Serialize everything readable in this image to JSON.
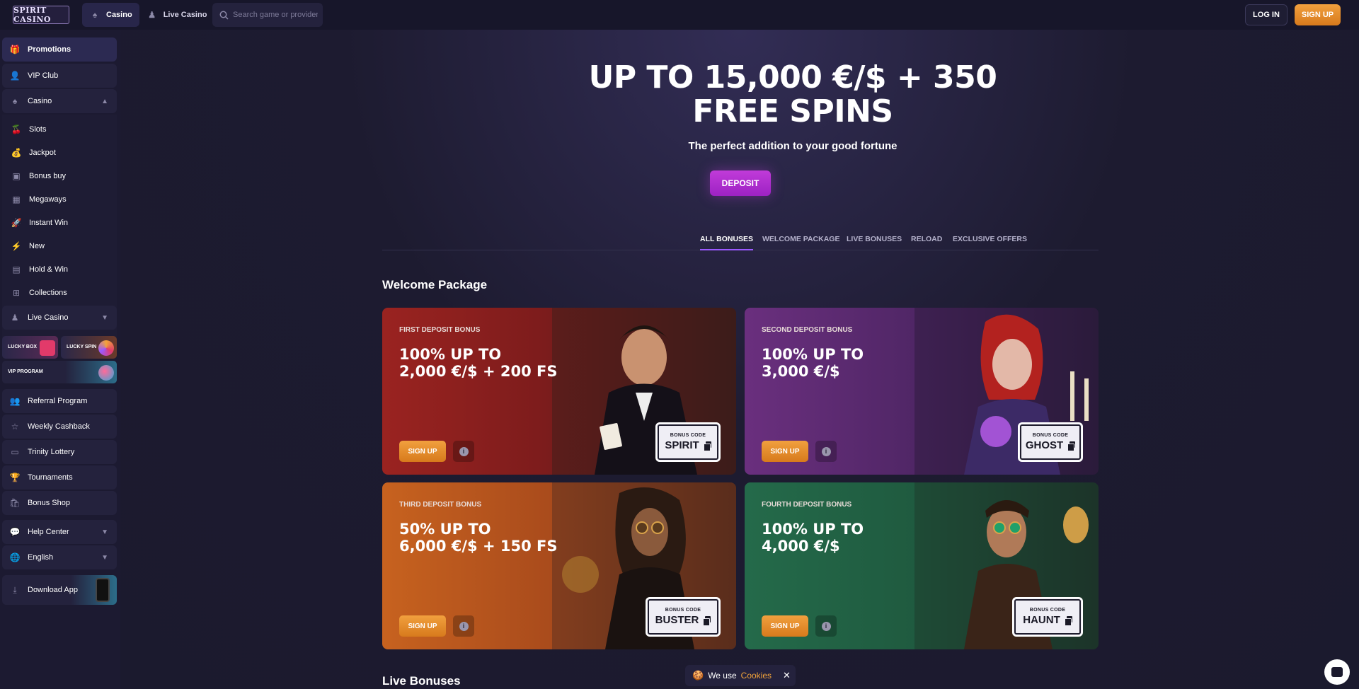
{
  "header": {
    "logo_text": "SPIRIT CASINO",
    "tabs": [
      {
        "label": "Casino",
        "icon": "spade-icon"
      },
      {
        "label": "Live Casino",
        "icon": "dealer-icon"
      }
    ],
    "search_placeholder": "Search game or provider",
    "login_label": "LOG IN",
    "signup_label": "SIGN UP"
  },
  "sidebar": {
    "promotions": "Promotions",
    "vip_club": "VIP Club",
    "casino": "Casino",
    "casino_items": [
      "Slots",
      "Jackpot",
      "Bonus buy",
      "Megaways",
      "Instant Win",
      "New",
      "Hold & Win",
      "Collections"
    ],
    "live_casino": "Live Casino",
    "lucky_box": "LUCKY BOX",
    "lucky_spin": "LUCKY SPIN",
    "vip_program": "VIP PROGRAM",
    "referral": "Referral Program",
    "weekly_cashback": "Weekly Cashback",
    "trinity_lottery": "Trinity Lottery",
    "tournaments": "Tournaments",
    "bonus_shop": "Bonus Shop",
    "help_center": "Help Center",
    "language": "English",
    "download_app": "Download App"
  },
  "hero": {
    "title_line1": "UP TO 15,000 €/$ + 350",
    "title_line2": "FREE SPINS",
    "subtitle": "The perfect addition to your good fortune",
    "deposit_label": "DEPOSIT"
  },
  "filters": [
    "ALL BONUSES",
    "WELCOME PACKAGE",
    "LIVE BONUSES",
    "RELOAD",
    "EXCLUSIVE OFFERS"
  ],
  "welcome": {
    "title": "Welcome Package",
    "cards": [
      {
        "label": "FIRST DEPOSIT BONUS",
        "line1": "100% UP TO",
        "line2": "2,000 €/$ + 200 FS",
        "signup": "SIGN UP",
        "code_label": "BONUS CODE",
        "code": "SPIRIT",
        "color": "#8e1f1c"
      },
      {
        "label": "SECOND DEPOSIT BONUS",
        "line1": "100% UP TO",
        "line2": "3,000 €/$",
        "signup": "SIGN UP",
        "code_label": "BONUS CODE",
        "code": "GHOST",
        "color": "#5a2a6e"
      },
      {
        "label": "THIRD DEPOSIT BONUS",
        "line1": "50% UP TO",
        "line2": "6,000 €/$ + 150 FS",
        "signup": "SIGN UP",
        "code_label": "BONUS CODE",
        "code": "BUSTER",
        "color": "#b5561f"
      },
      {
        "label": "FOURTH DEPOSIT BONUS",
        "line1": "100% UP TO",
        "line2": "4,000 €/$",
        "signup": "SIGN UP",
        "code_label": "BONUS CODE",
        "code": "HAUNT",
        "color": "#1f5a3f"
      }
    ]
  },
  "live_bonuses_title": "Live Bonuses",
  "cookie": {
    "text": "We use",
    "link": "Cookies",
    "close": "✕"
  },
  "colors": {
    "accent": "#9b59ff",
    "brand_orange": "#e8902c",
    "deposit_purple": "#b02fcf",
    "background": "#1b1a2e"
  }
}
